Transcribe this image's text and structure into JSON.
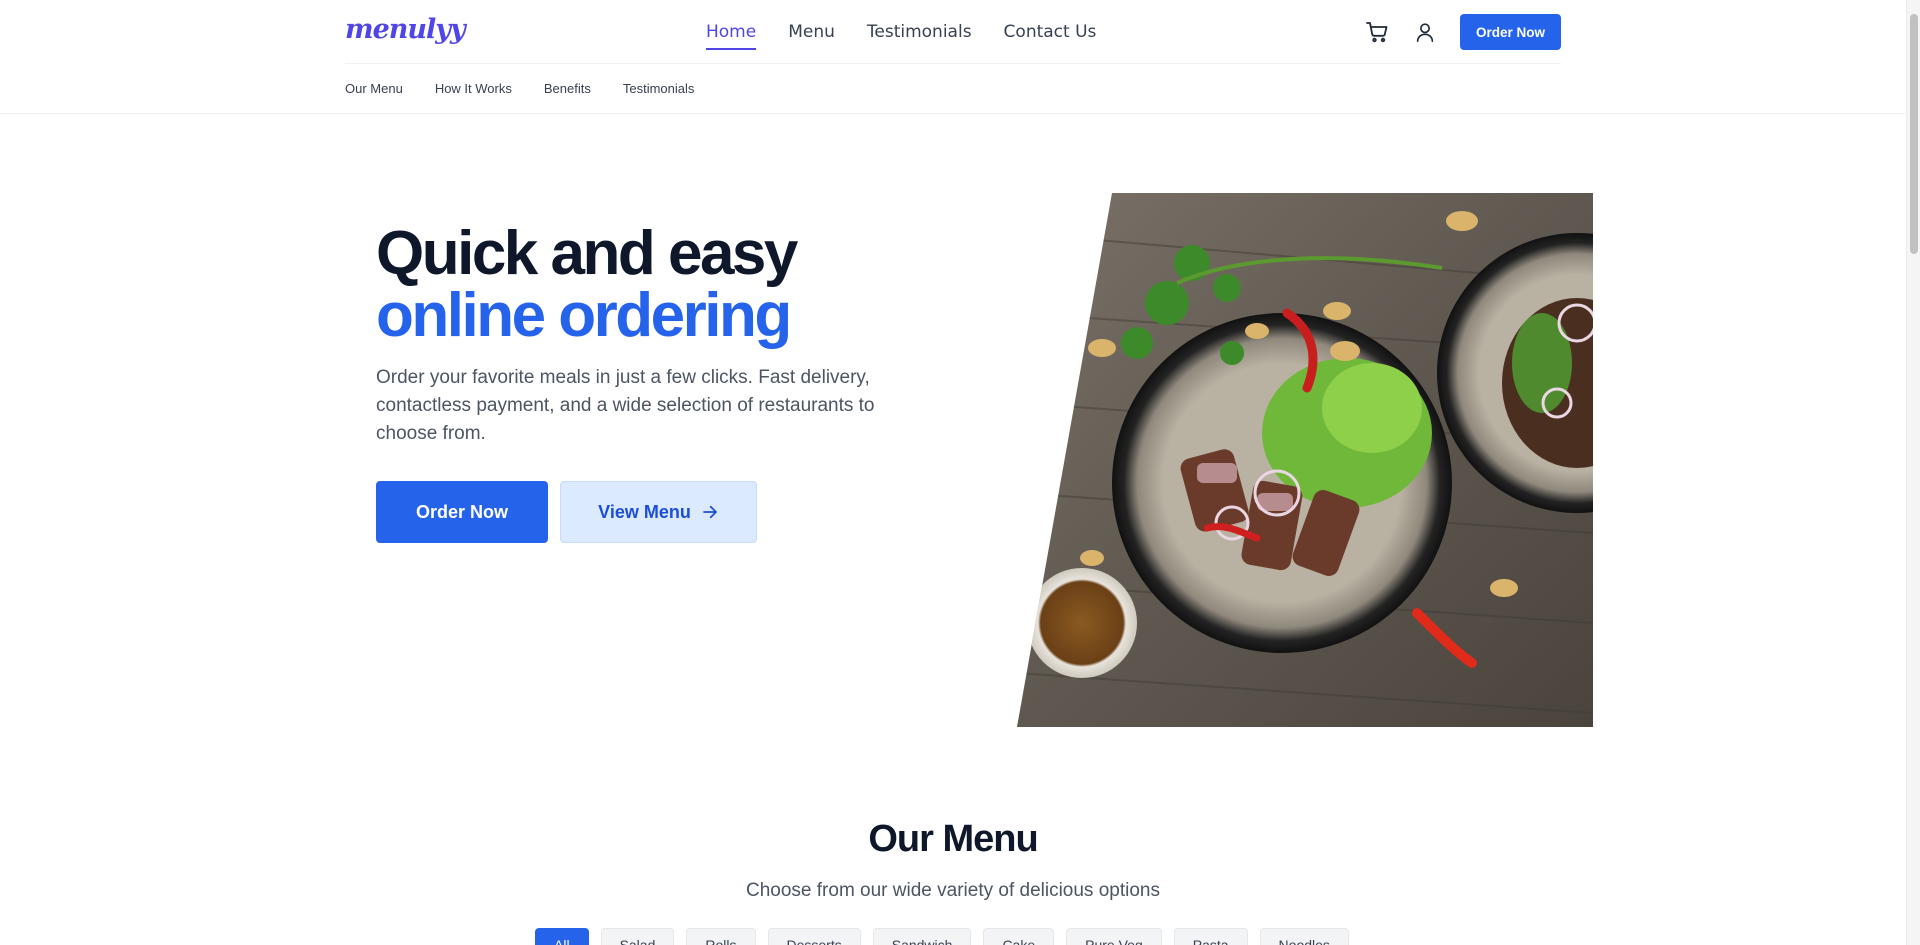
{
  "brand": {
    "logo": "menulyy",
    "accent": "#2563eb",
    "logo_color": "#4f46e5"
  },
  "nav": {
    "items": [
      {
        "label": "Home",
        "active": true
      },
      {
        "label": "Menu",
        "active": false
      },
      {
        "label": "Testimonials",
        "active": false
      },
      {
        "label": "Contact Us",
        "active": false
      }
    ],
    "cart_icon": "cart-icon",
    "user_icon": "user-icon",
    "order_label": "Order Now"
  },
  "subnav": {
    "items": [
      "Our Menu",
      "How It Works",
      "Benefits",
      "Testimonials"
    ]
  },
  "hero": {
    "title_line1": "Quick and easy",
    "title_line2": "online ordering",
    "subtitle": "Order your favorite meals in just a few clicks. Fast delivery, contactless payment, and a wide selection of restaurants to choose from.",
    "primary_label": "Order Now",
    "secondary_label": "View Menu",
    "secondary_icon": "arrow-right-icon",
    "image": "food-plate-photo"
  },
  "menu": {
    "title": "Our Menu",
    "subtitle": "Choose from our wide variety of delicious options",
    "filters": [
      "All",
      "Salad",
      "Rolls",
      "Desserts",
      "Sandwich",
      "Cake",
      "Pure Veg",
      "Pasta",
      "Noodles"
    ],
    "active_filter": "All"
  }
}
